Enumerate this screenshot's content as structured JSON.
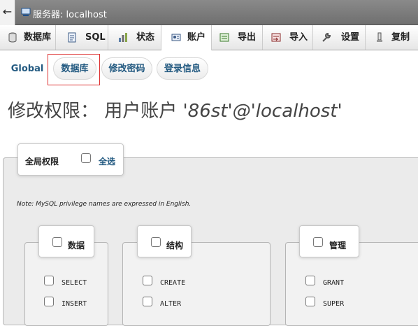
{
  "window": {
    "title": "服务器: localhost"
  },
  "tabs": [
    {
      "label": "数据库",
      "icon": "database-icon"
    },
    {
      "label": "SQL",
      "icon": "sql-icon"
    },
    {
      "label": "状态",
      "icon": "status-icon"
    },
    {
      "label": "账户",
      "icon": "accounts-icon",
      "active": true
    },
    {
      "label": "导出",
      "icon": "export-icon"
    },
    {
      "label": "导入",
      "icon": "import-icon"
    },
    {
      "label": "设置",
      "icon": "wrench-icon"
    },
    {
      "label": "复制",
      "icon": "replication-icon"
    }
  ],
  "subtabs": [
    {
      "label": "Global"
    },
    {
      "label": "数据库",
      "highlighted": true
    },
    {
      "label": "修改密码"
    },
    {
      "label": "登录信息"
    }
  ],
  "page": {
    "title_prefix": "修改权限：  用户账户 ",
    "user": "'86st'@'localhost'"
  },
  "global_privs": {
    "legend": "全局权限",
    "select_all": "全选",
    "note": "Note: MySQL privilege names are expressed in English."
  },
  "groups": [
    {
      "legend": "数据",
      "privileges": [
        "SELECT",
        "INSERT"
      ]
    },
    {
      "legend": "结构",
      "privileges": [
        "CREATE",
        "ALTER"
      ]
    },
    {
      "legend": "管理",
      "privileges": [
        "GRANT",
        "SUPER"
      ]
    }
  ],
  "colors": {
    "accent": "#235a81",
    "highlight": "#dd3333"
  }
}
